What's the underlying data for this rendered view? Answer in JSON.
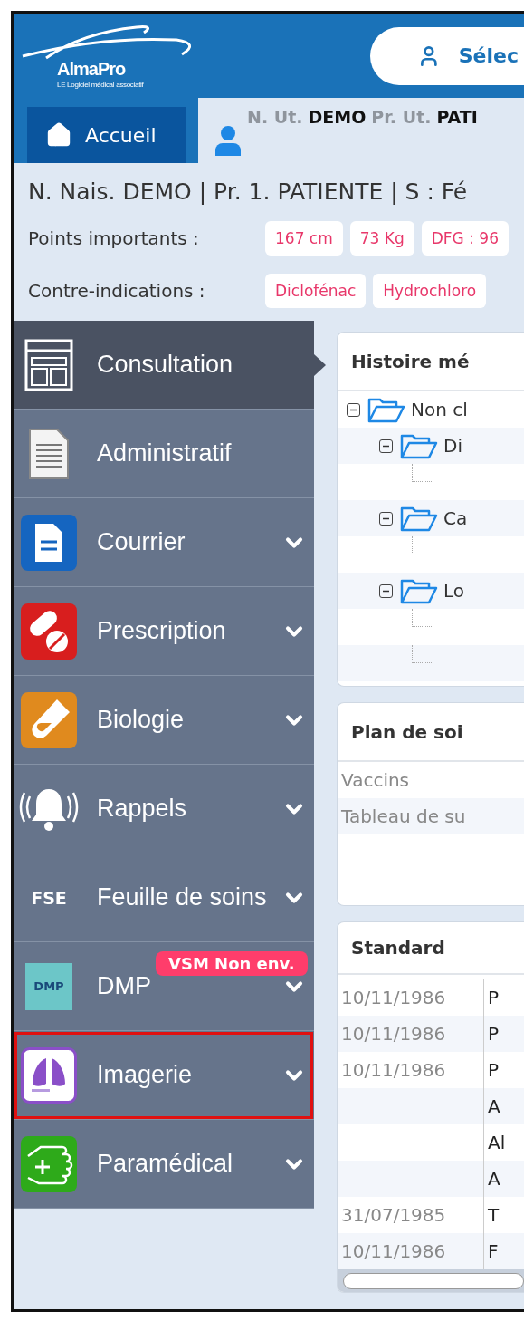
{
  "header": {
    "logo": {
      "name": "AlmaPro",
      "tagline": "LE Logiciel médical associatif"
    },
    "search_button": "Sélec"
  },
  "tabs": [
    {
      "kind": "home",
      "label": "Accueil",
      "selected": false
    },
    {
      "kind": "patient",
      "selected": true,
      "parts": [
        {
          "kind": "label",
          "text": "N. Ut."
        },
        {
          "kind": "value",
          "text": "DEMO"
        },
        {
          "kind": "label",
          "text": "Pr. Ut."
        },
        {
          "kind": "value",
          "text": "PATI"
        }
      ]
    }
  ],
  "patient_line": "N. Nais. DEMO | Pr. 1. PATIENTE | S : Fé",
  "points_importants": {
    "label": "Points importants :",
    "chips": [
      "167 cm",
      "73 Kg",
      "DFG : 96"
    ]
  },
  "contre_indications": {
    "label": "Contre-indications :",
    "chips": [
      "Diclofénac",
      "Hydrochloro"
    ]
  },
  "sidebar": {
    "items": [
      {
        "label": "Consultation",
        "kind": "layout",
        "selected": true,
        "has_submenu": false,
        "highlighted": false
      },
      {
        "label": "Administratif",
        "kind": "document",
        "selected": false,
        "has_submenu": false,
        "highlighted": false
      },
      {
        "label": "Courrier",
        "kind": "letter",
        "selected": false,
        "has_submenu": true,
        "highlighted": false
      },
      {
        "label": "Prescription",
        "kind": "pills",
        "selected": false,
        "has_submenu": true,
        "highlighted": false
      },
      {
        "label": "Biologie",
        "kind": "tube",
        "selected": false,
        "has_submenu": true,
        "highlighted": false
      },
      {
        "label": "Rappels",
        "kind": "bell",
        "selected": false,
        "has_submenu": true,
        "highlighted": false
      },
      {
        "label": "Feuille de soins",
        "kind": "text",
        "icon_text": "FSE",
        "selected": false,
        "has_submenu": true,
        "highlighted": false
      },
      {
        "label": "DMP",
        "kind": "dmp",
        "icon_text": "DMP",
        "badge": "VSM Non env.",
        "selected": false,
        "has_submenu": true,
        "highlighted": false
      },
      {
        "label": "Imagerie",
        "kind": "lungs",
        "selected": false,
        "has_submenu": true,
        "highlighted": true
      },
      {
        "label": "Paramédical",
        "kind": "hand",
        "selected": false,
        "has_submenu": true,
        "highlighted": false
      }
    ]
  },
  "histoire": {
    "title": "Histoire mé",
    "tree": [
      {
        "label": "Non cl",
        "expanded": true,
        "children": [
          {
            "label": "Di",
            "expanded": true,
            "children": [
              {
                "kind": "leaf"
              }
            ]
          },
          {
            "label": "Ca",
            "expanded": true,
            "children": [
              {
                "kind": "leaf"
              }
            ]
          },
          {
            "label": "Lo",
            "expanded": true,
            "children": [
              {
                "kind": "leaf"
              },
              {
                "kind": "leaf"
              }
            ]
          }
        ]
      }
    ]
  },
  "plan_de_soins": {
    "title": "Plan de soi",
    "rows": [
      "Vaccins",
      "Tableau de su"
    ]
  },
  "standard": {
    "title": "Standard",
    "rows": [
      {
        "date": "10/11/1986",
        "column_2": "P"
      },
      {
        "date": "10/11/1986",
        "column_2": "P"
      },
      {
        "date": "10/11/1986",
        "column_2": "P"
      },
      {
        "column_2": "A"
      },
      {
        "column_2": "Al"
      },
      {
        "column_2": "A"
      },
      {
        "date": "31/07/1985",
        "column_2": "T"
      },
      {
        "date": "10/11/1986",
        "column_2": "F"
      }
    ]
  }
}
